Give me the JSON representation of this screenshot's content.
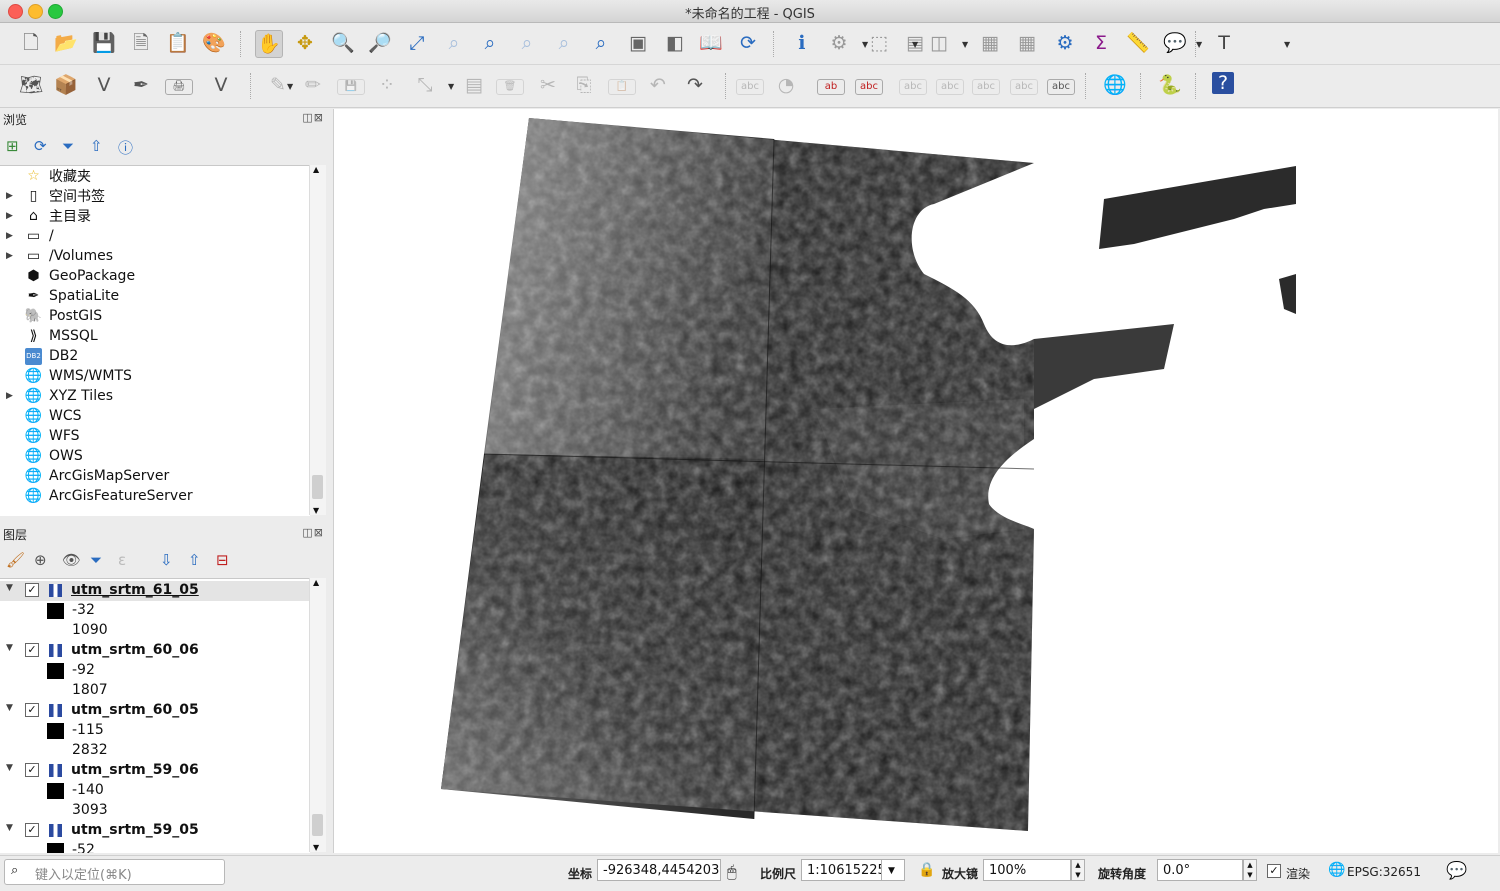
{
  "window": {
    "title": "*未命名的工程 - QGIS"
  },
  "toolbar1": [
    {
      "name": "new-project-icon",
      "glyph": "🗋"
    },
    {
      "name": "open-project-icon",
      "glyph": "📂"
    },
    {
      "name": "save-project-icon",
      "glyph": "💾"
    },
    {
      "name": "new-print-layout-icon",
      "glyph": "🗎"
    },
    {
      "name": "layout-manager-icon",
      "glyph": "📋"
    },
    {
      "name": "style-manager-icon",
      "glyph": "🎨"
    },
    {
      "name": "pan-icon",
      "glyph": "✋"
    },
    {
      "name": "pan-to-selection-icon",
      "glyph": "✥"
    },
    {
      "name": "zoom-in-icon",
      "glyph": "🔍"
    },
    {
      "name": "zoom-out-icon",
      "glyph": "🔎"
    },
    {
      "name": "zoom-full-icon",
      "glyph": "⤢"
    },
    {
      "name": "zoom-to-selection-icon",
      "glyph": "⌕"
    },
    {
      "name": "zoom-to-layer-icon",
      "glyph": "⌕"
    },
    {
      "name": "zoom-native-icon",
      "glyph": "⌕"
    },
    {
      "name": "zoom-last-icon",
      "glyph": "⌕"
    },
    {
      "name": "zoom-next-icon",
      "glyph": "⌕"
    },
    {
      "name": "new-map-view-icon",
      "glyph": "▣"
    },
    {
      "name": "new-3d-view-icon",
      "glyph": "◧"
    },
    {
      "name": "spatial-bookmark-icon",
      "glyph": "📖"
    },
    {
      "name": "refresh-icon",
      "glyph": "⟳"
    },
    {
      "name": "identify-icon",
      "glyph": "ℹ"
    },
    {
      "name": "run-action-icon",
      "glyph": "⚙"
    },
    {
      "name": "select-features-icon",
      "glyph": "⬚"
    },
    {
      "name": "select-by-value-icon",
      "glyph": "▤"
    },
    {
      "name": "deselect-icon",
      "glyph": "◫"
    },
    {
      "name": "attribute-table-icon",
      "glyph": "▦"
    },
    {
      "name": "field-calculator-icon",
      "glyph": "▦"
    },
    {
      "name": "processing-toolbox-icon",
      "glyph": "⚙"
    },
    {
      "name": "statistics-icon",
      "glyph": "Σ"
    },
    {
      "name": "measure-icon",
      "glyph": "📏"
    },
    {
      "name": "map-tips-icon",
      "glyph": "💬"
    },
    {
      "name": "text-annotation-icon",
      "glyph": "T"
    }
  ],
  "toolbar2": [
    {
      "name": "add-data-source-icon",
      "glyph": "🗺"
    },
    {
      "name": "new-geopackage-layer-icon",
      "glyph": "📦"
    },
    {
      "name": "new-shapefile-layer-icon",
      "glyph": "V"
    },
    {
      "name": "new-temporary-layer-icon",
      "glyph": "✒"
    },
    {
      "name": "new-virtual-layer-icon",
      "glyph": "🖨"
    },
    {
      "name": "add-vector-layer-icon",
      "glyph": "V"
    },
    {
      "name": "current-edits-icon",
      "glyph": "✎"
    },
    {
      "name": "toggle-editing-icon",
      "glyph": "✏"
    },
    {
      "name": "save-edits-icon",
      "glyph": "💾"
    },
    {
      "name": "digitize-icon",
      "glyph": "⁘"
    },
    {
      "name": "vertex-tool-icon",
      "glyph": "⤡"
    },
    {
      "name": "modify-attributes-icon",
      "glyph": "▤"
    },
    {
      "name": "delete-selected-icon",
      "glyph": "🗑"
    },
    {
      "name": "cut-features-icon",
      "glyph": "✂"
    },
    {
      "name": "copy-features-icon",
      "glyph": "⎘"
    },
    {
      "name": "paste-features-icon",
      "glyph": "📋"
    },
    {
      "name": "undo-icon",
      "glyph": "↶"
    },
    {
      "name": "redo-icon",
      "glyph": "↷"
    },
    {
      "name": "label-toolbar-icon",
      "glyph": "abc"
    },
    {
      "name": "layer-diagram-icon",
      "glyph": "◔"
    },
    {
      "name": "highlight-pinned-labels-icon",
      "glyph": "ab"
    },
    {
      "name": "pin-labels-icon",
      "glyph": "abc"
    },
    {
      "name": "show-hide-labels-icon",
      "glyph": "abc"
    },
    {
      "name": "move-label-icon",
      "glyph": "abc"
    },
    {
      "name": "rotate-label-icon",
      "glyph": "abc"
    },
    {
      "name": "change-label-icon",
      "glyph": "abc"
    },
    {
      "name": "label-properties-icon",
      "glyph": "abc"
    },
    {
      "name": "georeferencer-icon",
      "glyph": "🌐"
    },
    {
      "name": "python-console-icon",
      "glyph": "🐍"
    },
    {
      "name": "help-icon",
      "glyph": "?"
    }
  ],
  "browser": {
    "title": "浏览",
    "items": [
      {
        "label": "收藏夹",
        "icon": "☆",
        "icon_name": "favorites-star-icon",
        "expand": false
      },
      {
        "label": "空间书签",
        "icon": "▯",
        "icon_name": "spatial-bookmarks-icon",
        "expand": true
      },
      {
        "label": "主目录",
        "icon": "⌂",
        "icon_name": "home-folder-icon",
        "expand": true
      },
      {
        "label": "/",
        "icon": "▭",
        "icon_name": "folder-icon",
        "expand": true
      },
      {
        "label": "/Volumes",
        "icon": "▭",
        "icon_name": "folder-icon",
        "expand": true
      },
      {
        "label": "GeoPackage",
        "icon": "⬢",
        "icon_name": "geopackage-icon",
        "expand": false
      },
      {
        "label": "SpatiaLite",
        "icon": "✒",
        "icon_name": "spatialite-icon",
        "expand": false
      },
      {
        "label": "PostGIS",
        "icon": "🐘",
        "icon_name": "postgis-elephant-icon",
        "expand": false
      },
      {
        "label": "MSSQL",
        "icon": "⟫",
        "icon_name": "mssql-icon",
        "expand": false
      },
      {
        "label": "DB2",
        "icon": "DB2",
        "icon_name": "db2-icon",
        "expand": false
      },
      {
        "label": "WMS/WMTS",
        "icon": "🌐",
        "icon_name": "wms-globe-icon",
        "expand": false
      },
      {
        "label": "XYZ Tiles",
        "icon": "🌐",
        "icon_name": "xyz-globe-icon",
        "expand": true
      },
      {
        "label": "WCS",
        "icon": "🌐",
        "icon_name": "wcs-globe-icon",
        "expand": false
      },
      {
        "label": "WFS",
        "icon": "🌐",
        "icon_name": "wfs-globe-icon",
        "expand": false
      },
      {
        "label": "OWS",
        "icon": "🌐",
        "icon_name": "ows-globe-icon",
        "expand": false
      },
      {
        "label": "ArcGisMapServer",
        "icon": "🌐",
        "icon_name": "arcgis-map-globe-icon",
        "expand": false
      },
      {
        "label": "ArcGisFeatureServer",
        "icon": "🌐",
        "icon_name": "arcgis-feature-globe-icon",
        "expand": false
      }
    ]
  },
  "layers": {
    "title": "图层",
    "items": [
      {
        "name": "utm_srtm_61_05",
        "min": "-32",
        "max": "1090"
      },
      {
        "name": "utm_srtm_60_06",
        "min": "-92",
        "max": "1807"
      },
      {
        "name": "utm_srtm_60_05",
        "min": "-115",
        "max": "2832"
      },
      {
        "name": "utm_srtm_59_06",
        "min": "-140",
        "max": "3093"
      },
      {
        "name": "utm_srtm_59_05",
        "min": "-52",
        "max": ""
      }
    ]
  },
  "status": {
    "locator_placeholder": "键入以定位(⌘K)",
    "coord_label": "坐标",
    "coord_value": "-926348,4454203",
    "scale_label": "比例尺",
    "scale_value": "1:10615225",
    "magnifier_label": "放大镜",
    "magnifier_value": "100%",
    "rotation_label": "旋转角度",
    "rotation_value": "0.0°",
    "render_label": "渲染",
    "crs_value": "EPSG:32651"
  }
}
